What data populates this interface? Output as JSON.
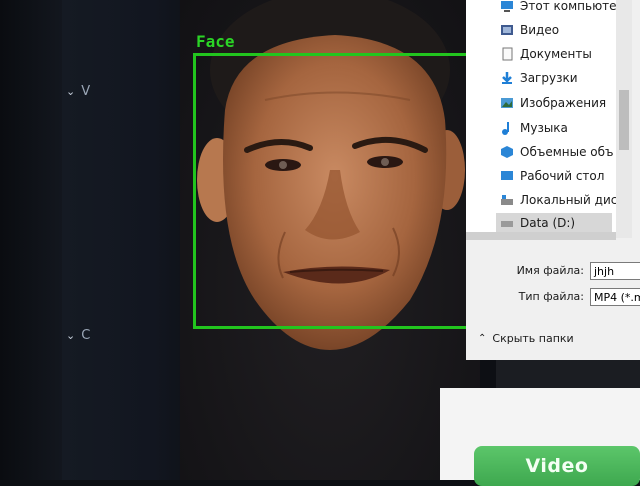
{
  "window": {
    "nav_items": [
      "V",
      "C"
    ]
  },
  "detection": {
    "label": "Face",
    "box_color": "#22c51e"
  },
  "file_dialog": {
    "tree": [
      {
        "label": "Этот компьютер",
        "icon": "computer-icon"
      },
      {
        "label": "Видео",
        "icon": "video-folder-icon"
      },
      {
        "label": "Документы",
        "icon": "documents-icon"
      },
      {
        "label": "Загрузки",
        "icon": "downloads-icon"
      },
      {
        "label": "Изображения",
        "icon": "pictures-icon"
      },
      {
        "label": "Музыка",
        "icon": "music-icon"
      },
      {
        "label": "Объемные объ",
        "icon": "3d-objects-icon"
      },
      {
        "label": "Рабочий стол",
        "icon": "desktop-icon"
      },
      {
        "label": "Локальный дис",
        "icon": "local-disk-icon"
      },
      {
        "label": "Data (D:)",
        "icon": "drive-icon"
      }
    ],
    "filename_label": "Имя файла:",
    "filename_value": "jhjh",
    "filetype_label": "Тип файла:",
    "filetype_value": "MP4 (*.m",
    "hide_folders_label": "Скрыть папки"
  },
  "video_button": {
    "label": "Video"
  }
}
